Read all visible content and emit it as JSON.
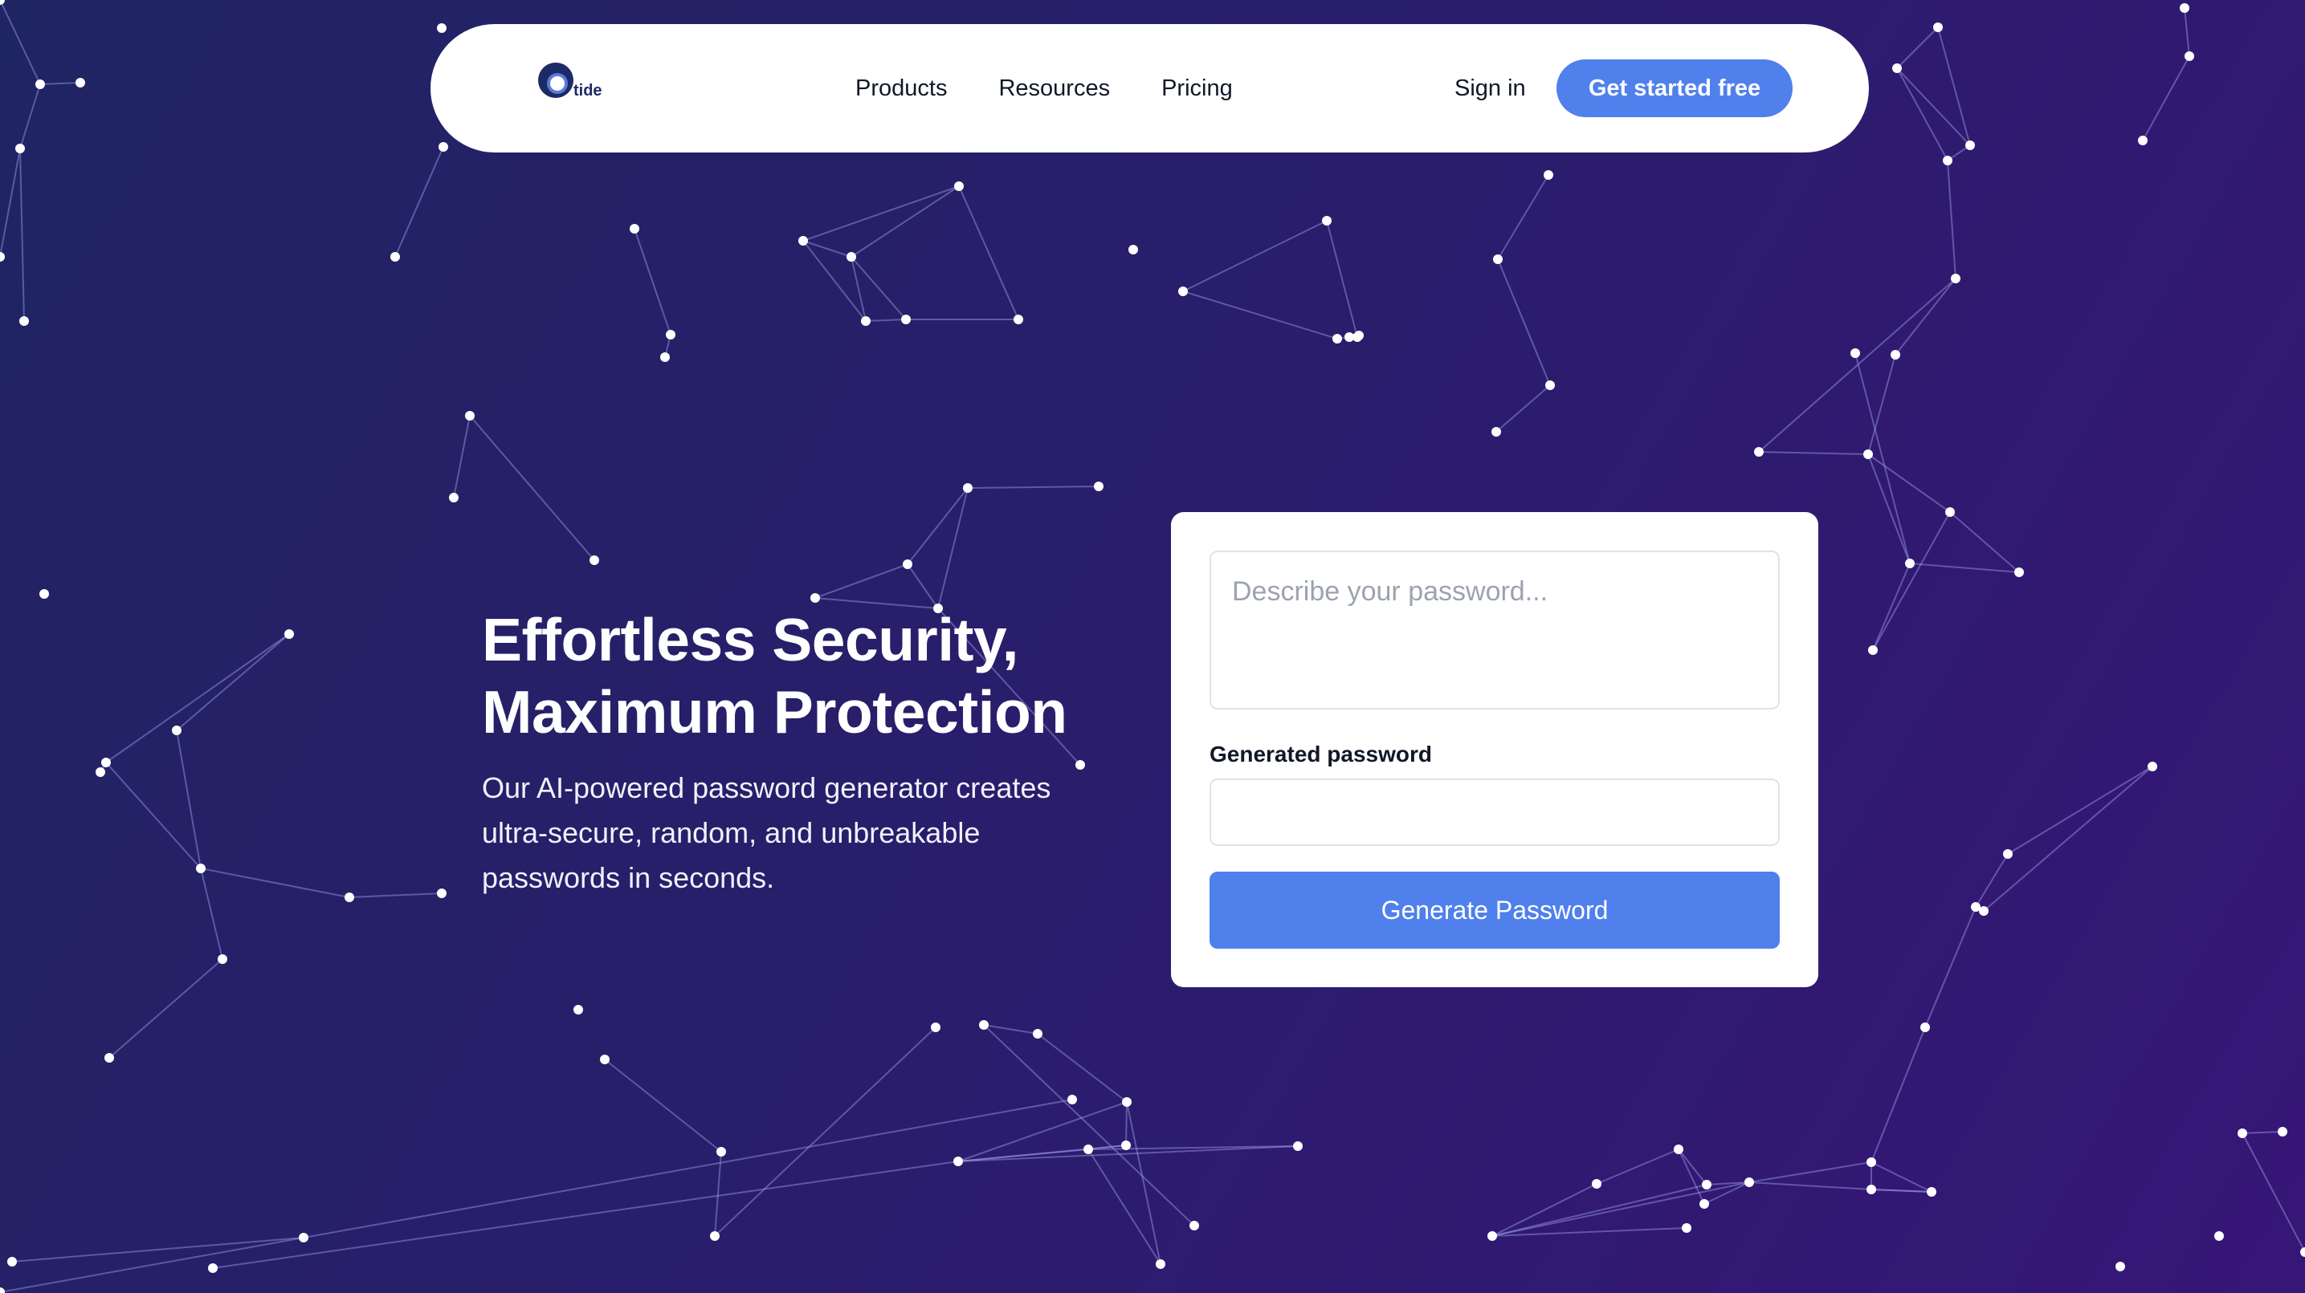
{
  "brand": {
    "logo_text": "tide"
  },
  "nav": {
    "links": [
      "Products",
      "Resources",
      "Pricing"
    ],
    "sign_in": "Sign in",
    "cta": "Get started free"
  },
  "hero": {
    "title_line1": "Effortless Security,",
    "title_line2": "Maximum Protection",
    "subtitle": "Our AI-powered password generator creates ultra-secure, random, and unbreakable passwords in seconds."
  },
  "generator": {
    "description_placeholder": "Describe your password...",
    "description_value": "",
    "output_label": "Generated password",
    "output_value": "",
    "button_label": "Generate Password"
  },
  "colors": {
    "background_start": "#1f2463",
    "background_end": "#361677",
    "accent": "#4f80ec"
  }
}
